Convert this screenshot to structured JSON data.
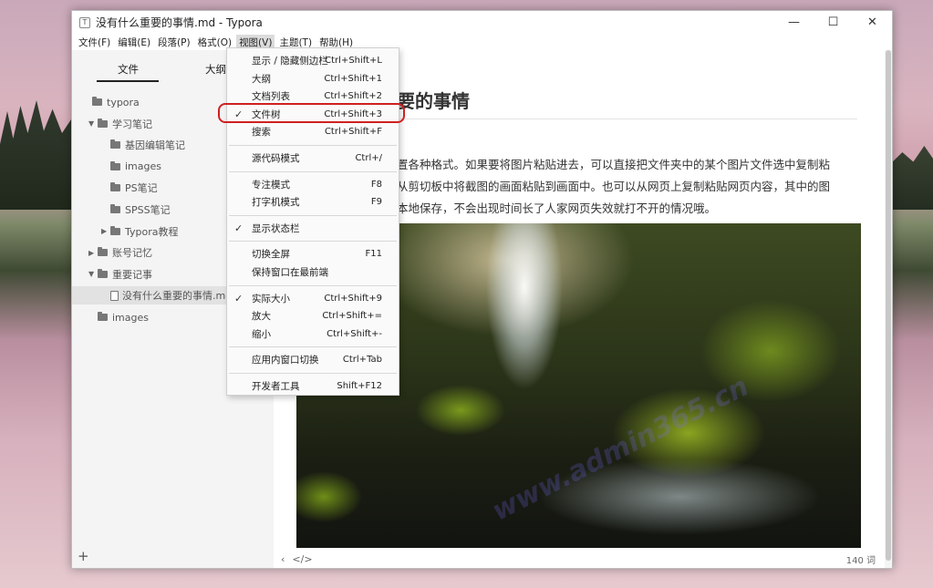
{
  "window": {
    "title": "没有什么重要的事情.md - Typora",
    "app_icon": "T",
    "controls": [
      "—",
      "☐",
      "✕"
    ]
  },
  "menubar": [
    "文件(F)",
    "编辑(E)",
    "段落(P)",
    "格式(O)",
    "视图(V)",
    "主题(T)",
    "帮助(H)"
  ],
  "sidebar": {
    "tabs": [
      "文件",
      "大纲"
    ],
    "tree": [
      {
        "label": "typora",
        "type": "folder",
        "depth": 0,
        "arrow": ""
      },
      {
        "label": "学习笔记",
        "type": "folder",
        "depth": 1,
        "arrow": "▼"
      },
      {
        "label": "基因编辑笔记",
        "type": "folder",
        "depth": 2,
        "arrow": ""
      },
      {
        "label": "images",
        "type": "folder",
        "depth": 2,
        "arrow": ""
      },
      {
        "label": "PS笔记",
        "type": "folder",
        "depth": 2,
        "arrow": ""
      },
      {
        "label": "SPSS笔记",
        "type": "folder",
        "depth": 2,
        "arrow": ""
      },
      {
        "label": "Typora教程",
        "type": "folder",
        "depth": 2,
        "arrow": "▶"
      },
      {
        "label": "账号记忆",
        "type": "folder",
        "depth": 1,
        "arrow": "▶"
      },
      {
        "label": "重要记事",
        "type": "folder",
        "depth": 1,
        "arrow": "▼"
      },
      {
        "label": "没有什么重要的事情.md",
        "type": "file",
        "depth": 2,
        "arrow": "",
        "selected": true
      },
      {
        "label": "images",
        "type": "folder",
        "depth": 1,
        "arrow": ""
      }
    ],
    "add": "+"
  },
  "document": {
    "title": "要的事情",
    "lines": [
      "置各种格式。如果要将图片粘贴进去，可以直接把文件夹中的某个图片文件选中复制粘",
      "从剪切板中将截图的画面粘贴到画面中。也可以从网页上复制粘贴网页内容，其中的图",
      "本地保存，不会出现时间长了人家网页失效就打不开的情况哦。"
    ],
    "watermark": "www.admin365.cn"
  },
  "statusbar": {
    "left_icon": "‹",
    "code_icon": "</>",
    "word_count": "140 词"
  },
  "view_menu": {
    "items": [
      {
        "label": "显示 / 隐藏侧边栏",
        "shortcut": "Ctrl+Shift+L",
        "checked": false
      },
      {
        "label": "大纲",
        "shortcut": "Ctrl+Shift+1",
        "checked": false
      },
      {
        "label": "文档列表",
        "shortcut": "Ctrl+Shift+2",
        "checked": false
      },
      {
        "label": "文件树",
        "shortcut": "Ctrl+Shift+3",
        "checked": true,
        "highlighted": true
      },
      {
        "label": "搜索",
        "shortcut": "Ctrl+Shift+F",
        "checked": false
      },
      {
        "label": "源代码模式",
        "shortcut": "Ctrl+/",
        "checked": false,
        "sep_before": true
      },
      {
        "label": "专注模式",
        "shortcut": "F8",
        "checked": false,
        "sep_before": true
      },
      {
        "label": "打字机模式",
        "shortcut": "F9",
        "checked": false
      },
      {
        "label": "显示状态栏",
        "shortcut": "",
        "checked": true,
        "sep_before": true
      },
      {
        "label": "切换全屏",
        "shortcut": "F11",
        "checked": false,
        "sep_before": true
      },
      {
        "label": "保持窗口在最前端",
        "shortcut": "",
        "checked": false
      },
      {
        "label": "实际大小",
        "shortcut": "Ctrl+Shift+9",
        "checked": true,
        "sep_before": true
      },
      {
        "label": "放大",
        "shortcut": "Ctrl+Shift+=",
        "checked": false
      },
      {
        "label": "缩小",
        "shortcut": "Ctrl+Shift+-",
        "checked": false
      },
      {
        "label": "应用内窗口切换",
        "shortcut": "Ctrl+Tab",
        "checked": false,
        "sep_before": true
      },
      {
        "label": "开发者工具",
        "shortcut": "Shift+F12",
        "checked": false,
        "sep_before": true
      }
    ],
    "check_glyph": "✓"
  },
  "colors": {
    "highlight_ring": "#d02020",
    "menu_active": "#dcdcdc"
  }
}
